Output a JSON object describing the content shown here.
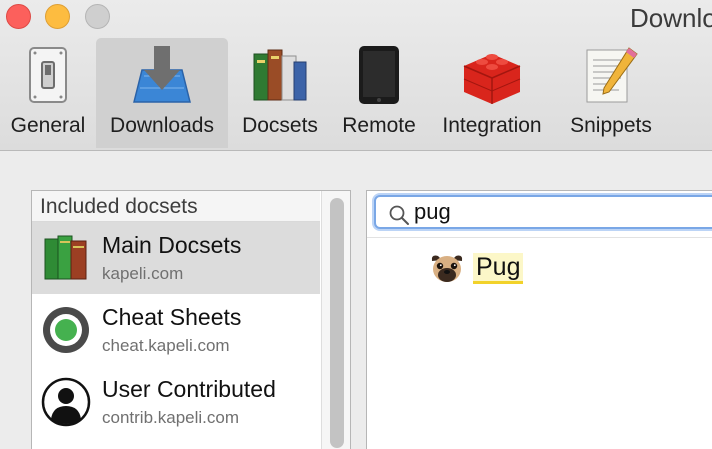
{
  "window": {
    "title": "Downlo"
  },
  "toolbar": {
    "tabs": [
      {
        "label": "General",
        "icon": "switch-icon"
      },
      {
        "label": "Downloads",
        "icon": "download-icon",
        "active": true
      },
      {
        "label": "Docsets",
        "icon": "books-icon"
      },
      {
        "label": "Remote",
        "icon": "tablet-icon"
      },
      {
        "label": "Integration",
        "icon": "lego-brick-icon"
      },
      {
        "label": "Snippets",
        "icon": "notepad-pencil-icon"
      }
    ]
  },
  "sources": {
    "header": "Included docsets",
    "items": [
      {
        "name": "Main Docsets",
        "host": "kapeli.com",
        "icon": "books-icon",
        "selected": true
      },
      {
        "name": "Cheat Sheets",
        "host": "cheat.kapeli.com",
        "icon": "cheat-sheet-icon"
      },
      {
        "name": "User Contributed",
        "host": "contrib.kapeli.com",
        "icon": "user-silhouette-icon"
      }
    ]
  },
  "search": {
    "value": "pug",
    "placeholder": ""
  },
  "results": [
    {
      "label": "Pug",
      "icon": "pug-icon"
    }
  ],
  "colors": {
    "highlight": "#fcf7c8",
    "highlight_underline": "#f2d22a",
    "focus_ring": "#7aa7e6"
  }
}
